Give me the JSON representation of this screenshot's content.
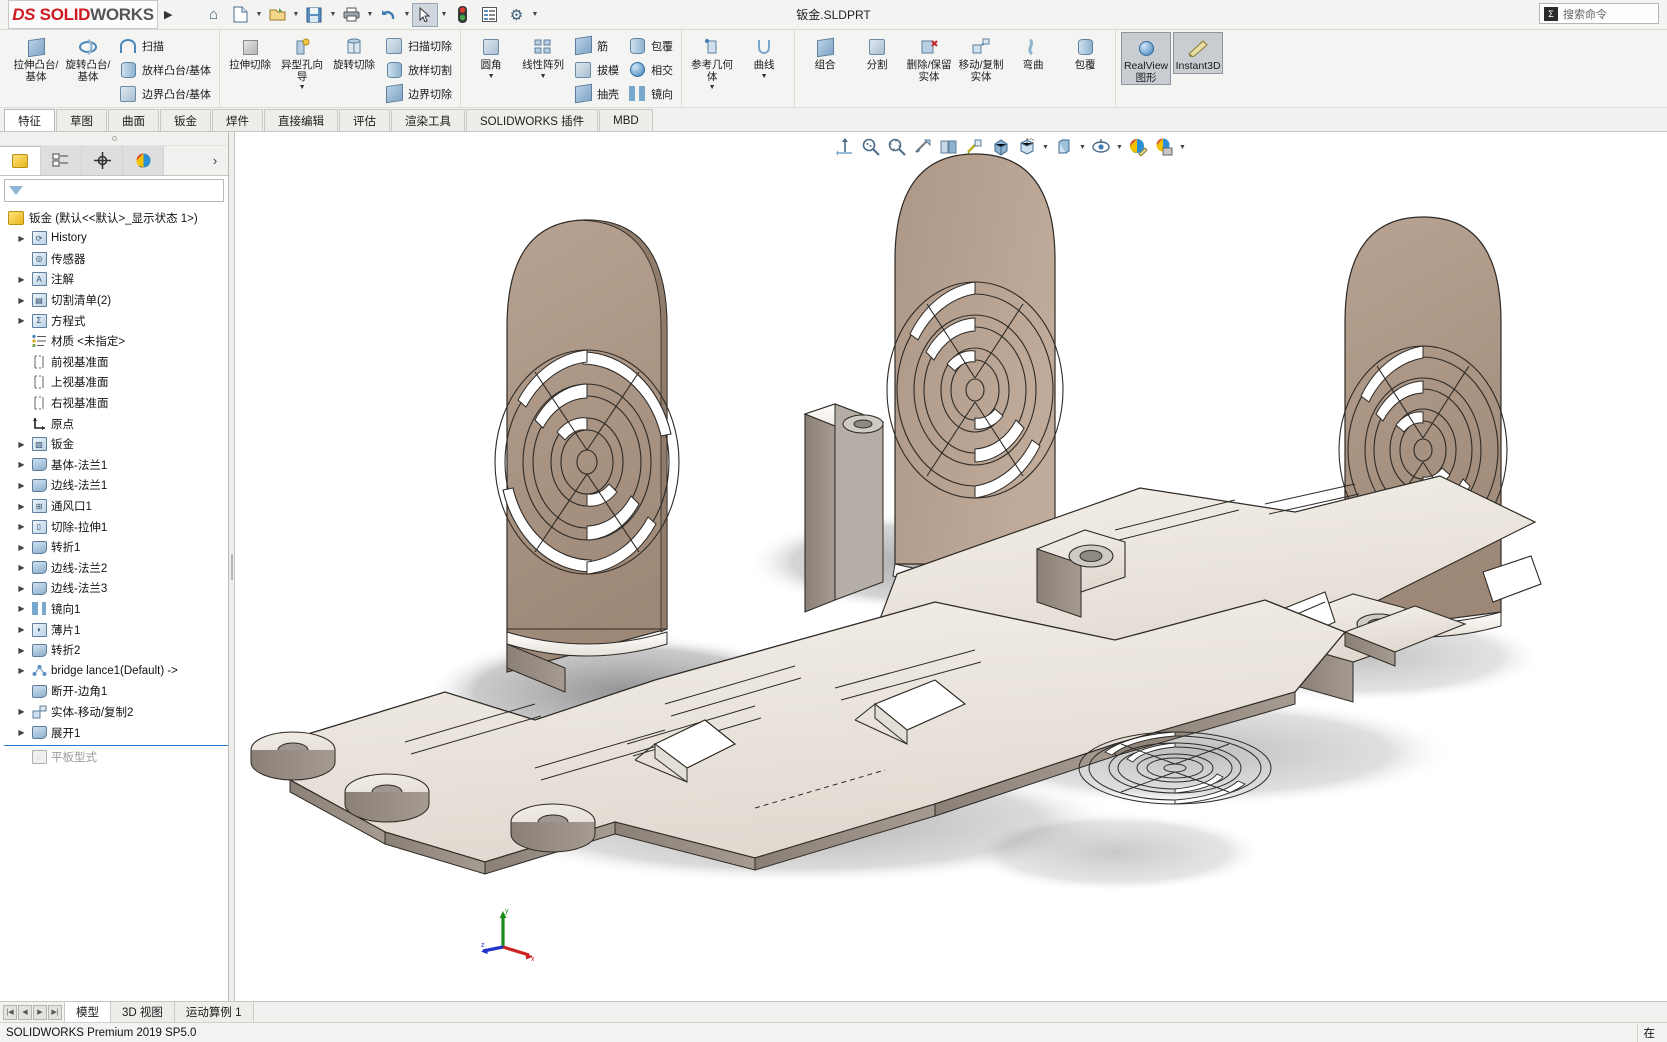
{
  "titlebar": {
    "logo_text_1": "DS",
    "logo_text_2": "SOLID",
    "logo_text_3": "WORKS",
    "document_title": "钣金.SLDPRT",
    "tools": [
      {
        "name": "home-icon",
        "glyph": "⌂"
      },
      {
        "name": "new-document-icon",
        "glyph": "🗋"
      },
      {
        "name": "open-document-icon",
        "glyph": "📂"
      },
      {
        "name": "save-icon",
        "glyph": "💾"
      },
      {
        "name": "print-icon",
        "glyph": "🖶"
      },
      {
        "name": "undo-icon",
        "glyph": "↰"
      },
      {
        "name": "select-arrow-icon",
        "glyph": "↖"
      },
      {
        "name": "rebuild-icon",
        "glyph": "🚦"
      },
      {
        "name": "options-list-icon",
        "glyph": "▤"
      },
      {
        "name": "settings-gear-icon",
        "glyph": "⚙"
      }
    ],
    "search_placeholder": "搜索命令"
  },
  "ribbon": {
    "groups": [
      {
        "name": "features-boss",
        "big": [
          {
            "label": "拉伸凸台/基体",
            "icon": "extrude-boss-icon",
            "dropdown": false
          },
          {
            "label": "旋转凸台/基体",
            "icon": "revolve-boss-icon",
            "dropdown": false
          }
        ],
        "small": [
          {
            "label": "扫描",
            "icon": "sweep-icon"
          },
          {
            "label": "放样凸台/基体",
            "icon": "loft-boss-icon"
          },
          {
            "label": "边界凸台/基体",
            "icon": "boundary-boss-icon"
          }
        ]
      },
      {
        "name": "features-cut",
        "big": [
          {
            "label": "拉伸切除",
            "icon": "extrude-cut-icon",
            "dropdown": false
          },
          {
            "label": "异型孔向导",
            "icon": "hole-wizard-icon",
            "dropdown": true
          },
          {
            "label": "旋转切除",
            "icon": "revolve-cut-icon",
            "dropdown": false
          }
        ],
        "small": [
          {
            "label": "扫描切除",
            "icon": "sweep-cut-icon"
          },
          {
            "label": "放样切割",
            "icon": "loft-cut-icon"
          },
          {
            "label": "边界切除",
            "icon": "boundary-cut-icon"
          }
        ]
      },
      {
        "name": "features-modify",
        "big": [
          {
            "label": "圆角",
            "icon": "fillet-icon",
            "dropdown": true
          },
          {
            "label": "线性阵列",
            "icon": "linear-pattern-icon",
            "dropdown": true
          }
        ],
        "small": [
          {
            "label": "筋",
            "icon": "rib-icon"
          },
          {
            "label": "拔模",
            "icon": "draft-icon"
          },
          {
            "label": "抽壳",
            "icon": "shell-icon"
          }
        ],
        "small2": [
          {
            "label": "包覆",
            "icon": "wrap-icon"
          },
          {
            "label": "相交",
            "icon": "intersect-icon"
          },
          {
            "label": "镜向",
            "icon": "mirror-icon"
          }
        ]
      },
      {
        "name": "reference-geometry",
        "big": [
          {
            "label": "参考几何体",
            "icon": "reference-geometry-icon",
            "dropdown": true
          },
          {
            "label": "曲线",
            "icon": "curves-icon",
            "dropdown": true
          }
        ]
      },
      {
        "name": "bodies",
        "big": [
          {
            "label": "组合",
            "icon": "combine-icon",
            "dropdown": false
          },
          {
            "label": "分割",
            "icon": "split-icon",
            "dropdown": false
          },
          {
            "label": "删除/保留实体",
            "icon": "delete-keep-body-icon",
            "dropdown": false
          },
          {
            "label": "移动/复制实体",
            "icon": "move-copy-body-icon",
            "dropdown": false
          },
          {
            "label": "弯曲",
            "icon": "flex-icon",
            "dropdown": false
          },
          {
            "label": "包覆",
            "icon": "wrap-body-icon",
            "dropdown": false
          }
        ]
      },
      {
        "name": "display",
        "big": [
          {
            "label": "RealView 图形",
            "icon": "realview-icon",
            "dropdown": false,
            "active": true
          },
          {
            "label": "Instant3D",
            "icon": "instant3d-icon",
            "dropdown": false,
            "active": true
          }
        ]
      }
    ]
  },
  "command_tabs": [
    {
      "label": "特征",
      "active": true
    },
    {
      "label": "草图",
      "active": false
    },
    {
      "label": "曲面",
      "active": false
    },
    {
      "label": "钣金",
      "active": false
    },
    {
      "label": "焊件",
      "active": false
    },
    {
      "label": "直接编辑",
      "active": false
    },
    {
      "label": "评估",
      "active": false
    },
    {
      "label": "渲染工具",
      "active": false
    },
    {
      "label": "SOLIDWORKS 插件",
      "active": false
    },
    {
      "label": "MBD",
      "active": false
    }
  ],
  "feature_manager": {
    "tabs": [
      {
        "name": "feature-tree-tab",
        "icon": "yellow-feature-icon",
        "active": true
      },
      {
        "name": "property-manager-tab",
        "icon": "property-manager-icon",
        "active": false
      },
      {
        "name": "configuration-manager-tab",
        "icon": "configuration-icon",
        "active": false
      },
      {
        "name": "display-manager-tab",
        "icon": "display-manager-icon",
        "active": false
      }
    ],
    "filter_placeholder": "",
    "root": "钣金  (默认<<默认>_显示状态 1>)",
    "items": [
      {
        "label": "History",
        "icon": "history-icon",
        "expand": true
      },
      {
        "label": "传感器",
        "icon": "sensors-icon",
        "expand": false
      },
      {
        "label": "注解",
        "icon": "annotations-icon",
        "expand": true
      },
      {
        "label": "切割清单(2)",
        "icon": "cut-list-icon",
        "expand": true
      },
      {
        "label": "方程式",
        "icon": "equations-icon",
        "expand": true
      },
      {
        "label": "材质 <未指定>",
        "icon": "material-icon",
        "expand": false
      },
      {
        "label": "前视基准面",
        "icon": "plane-icon",
        "expand": false
      },
      {
        "label": "上视基准面",
        "icon": "plane-icon",
        "expand": false
      },
      {
        "label": "右视基准面",
        "icon": "plane-icon",
        "expand": false
      },
      {
        "label": "原点",
        "icon": "origin-icon",
        "expand": false
      },
      {
        "label": "钣金",
        "icon": "sheetmetal-icon",
        "expand": true
      },
      {
        "label": "基体-法兰1",
        "icon": "base-flange-icon",
        "expand": true
      },
      {
        "label": "边线-法兰1",
        "icon": "edge-flange-icon",
        "expand": true
      },
      {
        "label": "通风口1",
        "icon": "vent-icon",
        "expand": true
      },
      {
        "label": "切除-拉伸1",
        "icon": "extrude-cut-feature-icon",
        "expand": true
      },
      {
        "label": "转折1",
        "icon": "jog-icon",
        "expand": true
      },
      {
        "label": "边线-法兰2",
        "icon": "edge-flange-icon",
        "expand": true
      },
      {
        "label": "边线-法兰3",
        "icon": "edge-flange-icon",
        "expand": true
      },
      {
        "label": "镜向1",
        "icon": "mirror-feature-icon",
        "expand": true
      },
      {
        "label": "薄片1",
        "icon": "tab-icon",
        "expand": true
      },
      {
        "label": "转折2",
        "icon": "jog-icon",
        "expand": true
      },
      {
        "label": "bridge lance1(Default) ->",
        "icon": "bridge-lance-icon",
        "expand": true
      },
      {
        "label": "断开-边角1",
        "icon": "break-corner-icon",
        "expand": false
      },
      {
        "label": "实体-移动/复制2",
        "icon": "move-copy-feature-icon",
        "expand": true
      },
      {
        "label": "展开1",
        "icon": "unfold-icon",
        "expand": true
      }
    ],
    "dimmed_item": {
      "label": "平板型式",
      "icon": "flat-pattern-icon"
    }
  },
  "view_toolbar": [
    {
      "name": "zoom-to-fit-icon",
      "glyph": "⤢"
    },
    {
      "name": "zoom-to-area-icon",
      "glyph": "🔍"
    },
    {
      "name": "previous-view-icon",
      "glyph": "🔎"
    },
    {
      "name": "section-view-icon",
      "glyph": "✂"
    },
    {
      "name": "view-orientation-icon",
      "glyph": "◩"
    },
    {
      "name": "display-style-icon",
      "glyph": "◪"
    },
    {
      "name": "hide-show-items-icon",
      "glyph": "▣"
    },
    {
      "name": "edit-appearance-icon",
      "glyph": "◧",
      "dropdown": true
    },
    {
      "name": "apply-scene-icon",
      "glyph": "▩",
      "dropdown": true
    },
    {
      "name": "view-settings-icon",
      "glyph": "◉",
      "dropdown": true
    },
    {
      "name": "appearance-palette-icon",
      "glyph": "🎨"
    },
    {
      "name": "scene-palette-icon",
      "glyph": "🎭",
      "dropdown": true
    }
  ],
  "viewport": {
    "model_name": "sheet-metal-bracket",
    "triad_labels": {
      "x": "x",
      "y": "y",
      "z": "z"
    },
    "colors": {
      "background": "#ffffff",
      "face_top": "#ece7e0",
      "face_bronze": "#ab9585",
      "face_side": "#8e8479",
      "shadow": "#888888",
      "edge": "#2a2a2a"
    }
  },
  "bottom_tabs": [
    {
      "label": "模型",
      "active": true
    },
    {
      "label": "3D 视图",
      "active": false
    },
    {
      "label": "运动算例 1",
      "active": false
    }
  ],
  "statusbar": {
    "left_text": "SOLIDWORKS Premium 2019 SP5.0",
    "right_text": "在"
  }
}
